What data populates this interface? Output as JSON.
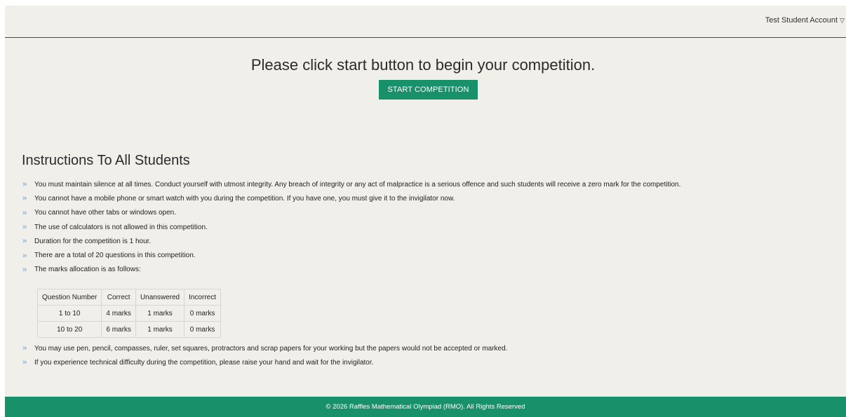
{
  "header": {
    "account_label": "Test Student Account"
  },
  "hero": {
    "title": "Please click start button to begin your competition.",
    "start_button_label": "START COMPETITION"
  },
  "instructions": {
    "title": "Instructions To All Students",
    "items": [
      "You must maintain silence at all times. Conduct yourself with utmost integrity. Any breach of integrity or any act of malpractice is a serious offence and such students will receive a zero mark for the competition.",
      "You cannot have a mobile phone or smart watch with you during the competition. If you have one, you must give it to the invigilator now.",
      "You cannot have other tabs or windows open.",
      "The use of calculators is not allowed in this competition.",
      "Duration for the competition is 1 hour.",
      "There are a total of 20 questions in this competition.",
      "The marks allocation is as follows:"
    ],
    "marks_table": {
      "headers": [
        "Question Number",
        "Correct",
        "Unanswered",
        "Incorrect"
      ],
      "rows": [
        [
          "1 to 10",
          "4 marks",
          "1 marks",
          "0 marks"
        ],
        [
          "10 to 20",
          "6 marks",
          "1 marks",
          "0 marks"
        ]
      ]
    },
    "tail_items": [
      "You may use pen, pencil, compasses, ruler, set squares, protractors and scrap papers for your working but the papers would not be accepted or marked.",
      "If you experience technical difficulty during the competition, please raise your hand and wait for the invigilator."
    ]
  },
  "footer": {
    "text": "© 2026 Raffles Mathematical Olympiad (RMO). All Rights Reserved"
  },
  "colors": {
    "accent": "#18916a",
    "background": "#f0efea",
    "bullet": "#6aa0d6"
  }
}
